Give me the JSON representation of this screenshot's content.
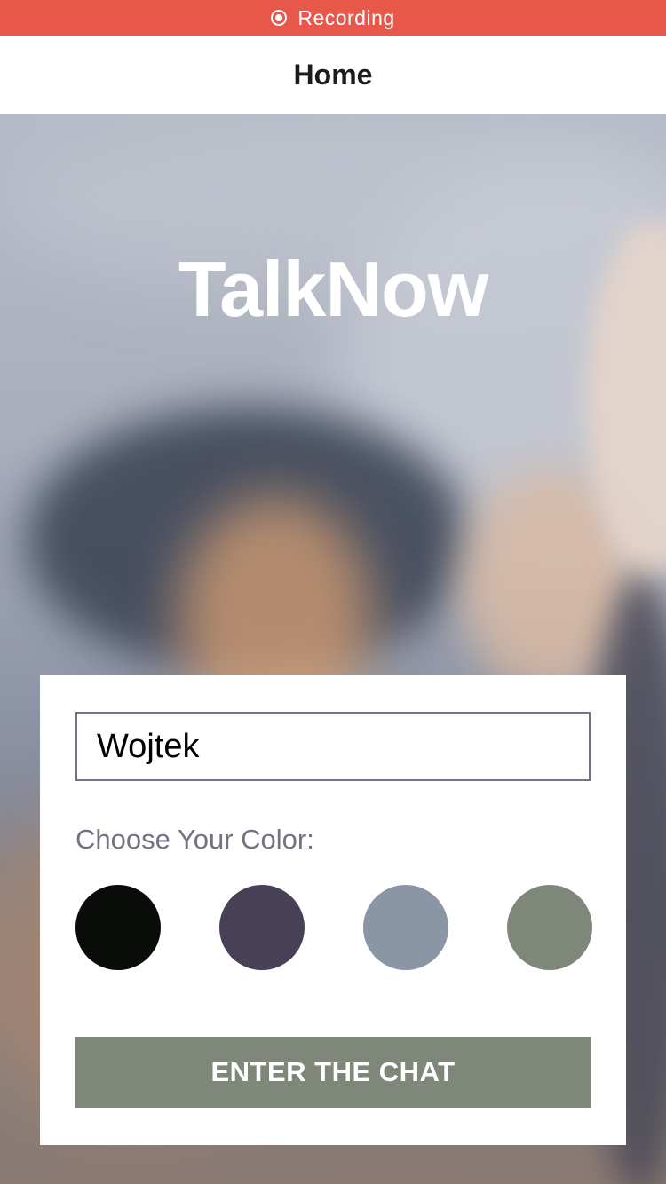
{
  "status_bar": {
    "text": "Recording",
    "icon": "record-icon",
    "color": "#e8584a"
  },
  "header": {
    "title": "Home"
  },
  "app": {
    "title": "TalkNow"
  },
  "form": {
    "name_value": "Wojtek",
    "color_label": "Choose Your Color:",
    "colors": [
      "#090C08",
      "#474056",
      "#8A95A5",
      "#7F877A"
    ],
    "button_label": "ENTER THE CHAT",
    "button_color": "#7f877a"
  }
}
